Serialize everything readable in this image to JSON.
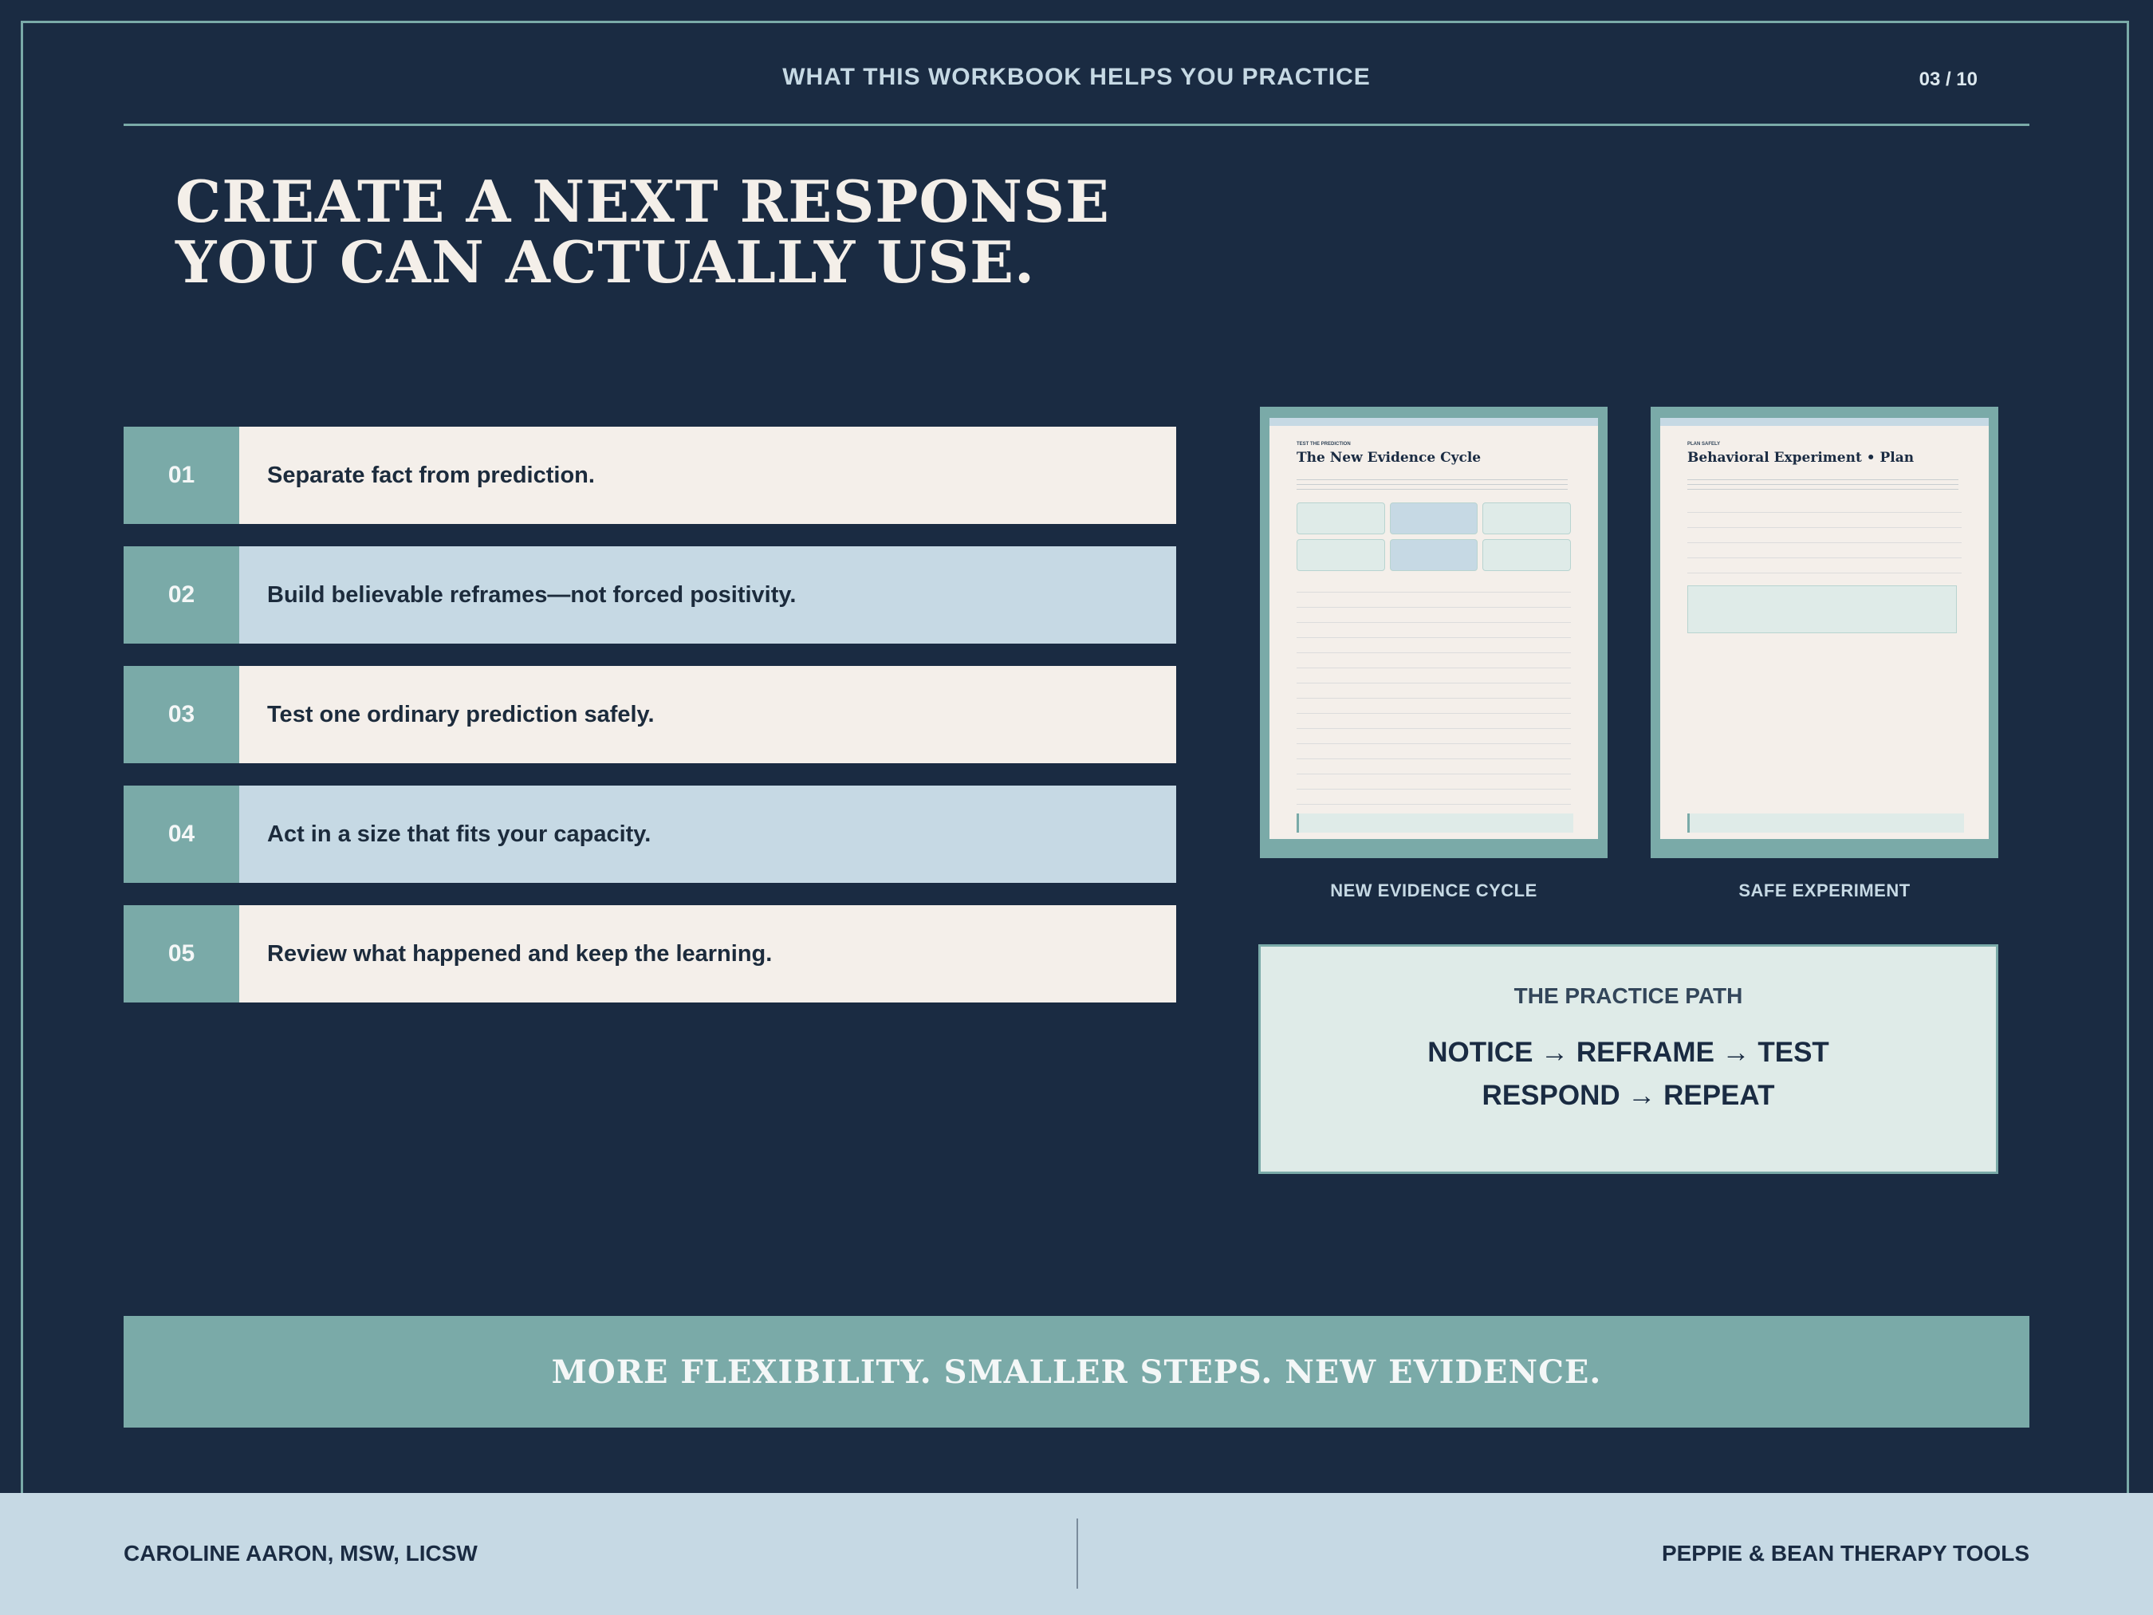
{
  "header": {
    "title": "WHAT THIS WORKBOOK HELPS YOU PRACTICE",
    "page": "03 / 10"
  },
  "main_title": {
    "line1": "CREATE A NEXT RESPONSE",
    "line2": "YOU CAN ACTUALLY USE."
  },
  "steps": [
    {
      "num": "01",
      "text": "Separate fact from prediction."
    },
    {
      "num": "02",
      "text": "Build believable reframes—not forced positivity."
    },
    {
      "num": "03",
      "text": "Test one ordinary prediction safely."
    },
    {
      "num": "04",
      "text": "Act in a size that fits your capacity."
    },
    {
      "num": "05",
      "text": "Review what happened and keep the learning."
    }
  ],
  "thumbnails": [
    {
      "caption": "NEW EVIDENCE CYCLE",
      "small": "TEST THE PREDICTION",
      "title": "The New Evidence Cycle"
    },
    {
      "caption": "SAFE EXPERIMENT",
      "small": "PLAN SAFELY",
      "title": "Behavioral Experiment • Plan"
    }
  ],
  "practice_path": {
    "label": "THE PRACTICE PATH",
    "line1": "NOTICE → REFRAME → TEST",
    "line2": "RESPOND → REPEAT"
  },
  "banner": "MORE FLEXIBILITY. SMALLER STEPS. NEW EVIDENCE.",
  "footer": {
    "author": "CAROLINE AARON, MSW, LICSW",
    "brand": "PEPPIE & BEAN THERAPY TOOLS"
  },
  "colors": {
    "background": "#1a2b42",
    "teal": "#7aaaa8",
    "light": "#f4efea",
    "blue": "#c6d9e4",
    "mint": "#dfebe8"
  }
}
